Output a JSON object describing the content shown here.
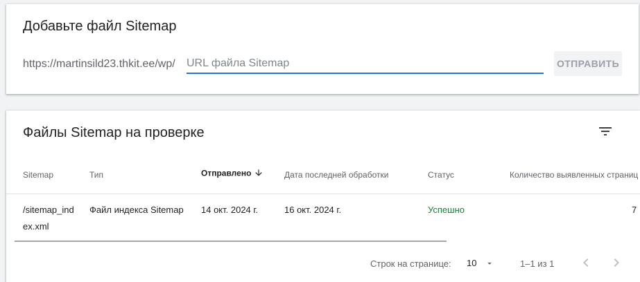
{
  "add_sitemap": {
    "title": "Добавьте файл Sitemap",
    "url_prefix": "https://martinsild23.thkit.ee/wp/",
    "input_placeholder": "URL файла Sitemap",
    "input_value": "",
    "submit_label": "ОТПРАВИТЬ"
  },
  "sitemaps_list": {
    "title": "Файлы Sitemap на проверке",
    "filter_icon": "filter-list-icon",
    "columns": {
      "sitemap": "Sitemap",
      "type": "Тип",
      "submitted": "Отправлено",
      "last_read": "Дата последней обработки",
      "status": "Статус",
      "discovered": "Количество выявленных страниц"
    },
    "sorted_column": "submitted",
    "sort_direction": "descending",
    "rows": [
      {
        "sitemap": "/sitemap_index.xml",
        "type": "Файл индекса Sitemap",
        "submitted": "14 окт. 2024 г.",
        "last_read": "16 окт. 2024 г.",
        "status": "Успешно",
        "discovered": "7"
      }
    ]
  },
  "pagination": {
    "rows_per_page_label": "Строк на странице:",
    "rows_per_page_value": "10",
    "range_label": "1–1 из 1",
    "prev_icon": "chevron-left-icon",
    "next_icon": "chevron-right-icon"
  },
  "colors": {
    "accent": "#1a73e8",
    "success": "#188038",
    "text_secondary": "#5f6368",
    "background": "#f1f3f4"
  }
}
